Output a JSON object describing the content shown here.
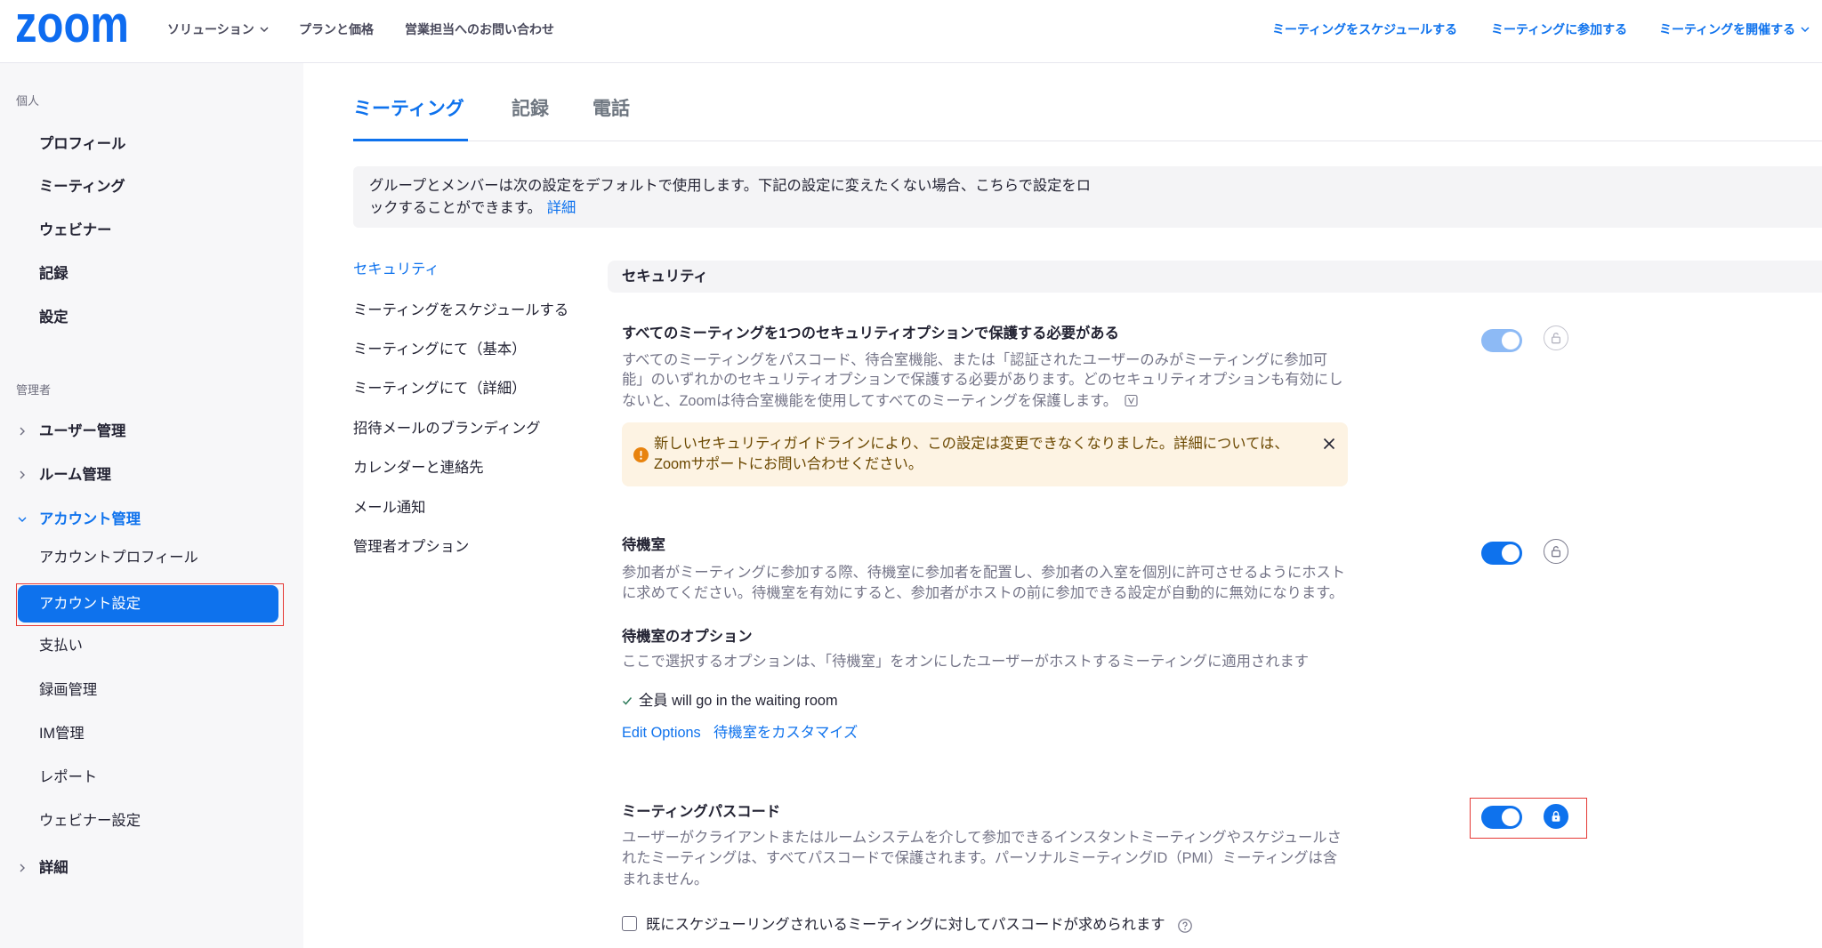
{
  "colors": {
    "accent": "#0e72ed",
    "toggle_disabled": "#8dbaf5",
    "sidebar_bg": "#f7f7f9",
    "warning_bg": "#fdf3e3",
    "warning_icon": "#e8830e",
    "highlight_outline": "#e53935"
  },
  "header": {
    "logo_text": "zoom",
    "nav": [
      {
        "label": "ソリューション",
        "icon": "caret-down-icon"
      },
      {
        "label": "プランと価格"
      },
      {
        "label": "営業担当へのお問い合わせ"
      }
    ],
    "actions": [
      {
        "label": "ミーティングをスケジュールする"
      },
      {
        "label": "ミーティングに参加する"
      },
      {
        "label": "ミーティングを開催する",
        "icon": "caret-down-icon"
      }
    ]
  },
  "sidebar": {
    "personal_heading": "個人",
    "personal_items": [
      {
        "label": "プロフィール"
      },
      {
        "label": "ミーティング"
      },
      {
        "label": "ウェビナー"
      },
      {
        "label": "記録"
      },
      {
        "label": "設定"
      }
    ],
    "admin_heading": "管理者",
    "admin_items": [
      {
        "label": "ユーザー管理",
        "icon": "chevron-right-icon",
        "expanded": false
      },
      {
        "label": "ルーム管理",
        "icon": "chevron-right-icon",
        "expanded": false
      },
      {
        "label": "アカウント管理",
        "icon": "chevron-down-icon",
        "expanded": true
      },
      {
        "label": "詳細",
        "icon": "chevron-right-icon",
        "expanded": false
      }
    ],
    "account_items": [
      {
        "label": "アカウントプロフィール"
      },
      {
        "label": "アカウント設定",
        "selected": true,
        "highlighted": true
      },
      {
        "label": "支払い"
      },
      {
        "label": "録画管理"
      },
      {
        "label": "IM管理"
      },
      {
        "label": "レポート"
      },
      {
        "label": "ウェビナー設定"
      }
    ]
  },
  "tabs": [
    {
      "label": "ミーティング",
      "active": true
    },
    {
      "label": "記録",
      "active": false
    },
    {
      "label": "電話",
      "active": false
    }
  ],
  "notice": {
    "lines": [
      "グループとメンバーは次の設定をデフォルトで使用します。下記の設定に変えたくない場合、こちらで設定をロ",
      "ックすることができます。"
    ],
    "link": "詳細"
  },
  "settings_nav": [
    {
      "label": "セキュリティ",
      "active": true
    },
    {
      "label": "ミーティングをスケジュールする"
    },
    {
      "label": "ミーティングにて（基本）"
    },
    {
      "label": "ミーティングにて（詳細）"
    },
    {
      "label": "招待メールのブランディング"
    },
    {
      "label": "カレンダーと連絡先"
    },
    {
      "label": "メール通知"
    },
    {
      "label": "管理者オプション"
    }
  ],
  "security": {
    "heading": "セキュリティ",
    "require_security_option": {
      "title": "すべてのミーティングを1つのセキュリティオプションで保護する必要がある",
      "description_lines": [
        "すべてのミーティングをパスコード、待合室機能、または「認証されたユーザーのみがミーティングに参加可",
        "能」のいずれかのセキュリティオプションで保護する必要があります。どのセキュリティオプションも有効にし",
        "ないと、Zoomは待合室機能を使用してすべてのミーティングを保護します。"
      ],
      "tooltip_icon": "v-box-icon",
      "toggle_on": true,
      "toggle_disabled": true,
      "locked": false,
      "lock_icon": "unlock-icon",
      "warning": {
        "icon": "warning-icon",
        "lines": [
          "新しいセキュリティガイドラインにより、この設定は変更できなくなりました。詳細については、",
          "Zoomサポートにお問い合わせください。"
        ],
        "close_icon": "close-icon"
      }
    },
    "waiting_room": {
      "title": "待機室",
      "description_lines": [
        "参加者がミーティングに参加する際、待機室に参加者を配置し、参加者の入室を個別に許可させるようにホスト",
        "に求めてください。待機室を有効にすると、参加者がホストの前に参加できる設定が自動的に無効になります。"
      ],
      "toggle_on": true,
      "locked": false,
      "lock_icon": "unlock-icon",
      "options_title": "待機室のオプション",
      "options_description": "ここで選択するオプションは、「待機室」をオンにしたユーザーがホストするミーティングに適用されます",
      "check_icon": "check-icon",
      "selected_option": "全員 will go in the waiting room",
      "links": [
        "Edit Options",
        "待機室をカスタマイズ"
      ]
    },
    "meeting_passcode": {
      "title": "ミーティングパスコード",
      "description_lines": [
        "ユーザーがクライアントまたはルームシステムを介して参加できるインスタントミーティングやスケジュールさ",
        "れたミーティングは、すべてパスコードで保護されます。パーソナルミーティングID（PMI）ミーティングは含",
        "まれません。"
      ],
      "toggle_on": true,
      "locked": true,
      "lock_icon": "lock-icon",
      "highlighted": true,
      "checkbox": {
        "label": "既にスケジューリングされいるミーティングに対してパスコードが求められます",
        "checked": false,
        "help_icon": "question-icon"
      }
    }
  }
}
